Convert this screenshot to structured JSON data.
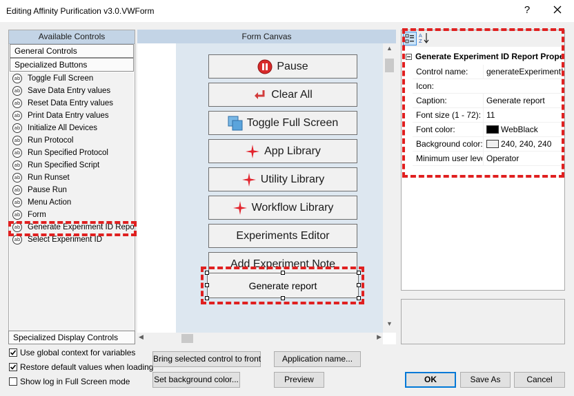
{
  "window": {
    "title": "Editing Affinity Purification v3.0.VWForm",
    "help_label": "?"
  },
  "left_panel": {
    "header": "Available Controls",
    "categories": [
      "General Controls",
      "Specialized Buttons"
    ],
    "items": [
      "Toggle Full Screen",
      "Save Data Entry values",
      "Reset Data Entry values",
      "Print Data Entry values",
      "Initialize All Devices",
      "Run Protocol",
      "Run Specified Protocol",
      "Run Specified Script",
      "Run Runset",
      "Pause Run",
      "Menu Action",
      "Form",
      "Generate Experiment ID Report",
      "Select Experiment ID"
    ],
    "item_icon_label": "ab",
    "display_category": "Specialized Display Controls"
  },
  "canvas": {
    "header": "Form Canvas",
    "buttons": [
      {
        "label": "Pause",
        "icon": "pause-icon"
      },
      {
        "label": "Clear All",
        "icon": "clear-arrow-icon"
      },
      {
        "label": "Toggle Full Screen",
        "icon": "fullscreen-icon"
      },
      {
        "label": "App Library",
        "icon": "sparkle-icon"
      },
      {
        "label": "Utility Library",
        "icon": "sparkle-icon"
      },
      {
        "label": "Workflow Library",
        "icon": "sparkle-icon"
      },
      {
        "label": "Experiments Editor",
        "icon": ""
      },
      {
        "label": "Add Experiment Note",
        "icon": ""
      }
    ],
    "selected_button": "Generate report"
  },
  "properties": {
    "category": "Generate Experiment ID Report Properties",
    "rows": [
      {
        "name": "Control name:",
        "value": "generateExperimentI"
      },
      {
        "name": "Icon:",
        "value": ""
      },
      {
        "name": "Caption:",
        "value": "Generate report"
      },
      {
        "name": "Font size (1 - 72):",
        "value": "11"
      },
      {
        "name": "Font color:",
        "value": "WebBlack",
        "swatch": "#000000"
      },
      {
        "name": "Background color:",
        "value": "240, 240, 240",
        "swatch": "#f0f0f0"
      },
      {
        "name": "Minimum user level:",
        "value": "Operator"
      }
    ]
  },
  "options": {
    "global_context": {
      "label": "Use global context for variables",
      "checked": true
    },
    "restore_defaults": {
      "label": "Restore default values when loading",
      "checked": true
    },
    "show_log": {
      "label": "Show log in Full Screen mode",
      "checked": false
    }
  },
  "actions": {
    "bring_front": "Bring selected control to front",
    "app_name": "Application name...",
    "set_bg": "Set background color...",
    "preview": "Preview",
    "ok": "OK",
    "save_as": "Save As",
    "cancel": "Cancel"
  },
  "colors": {
    "highlight_dash": "#e02020",
    "panel_header": "#c3d4e6",
    "canvas_bg": "#dde7f0"
  }
}
